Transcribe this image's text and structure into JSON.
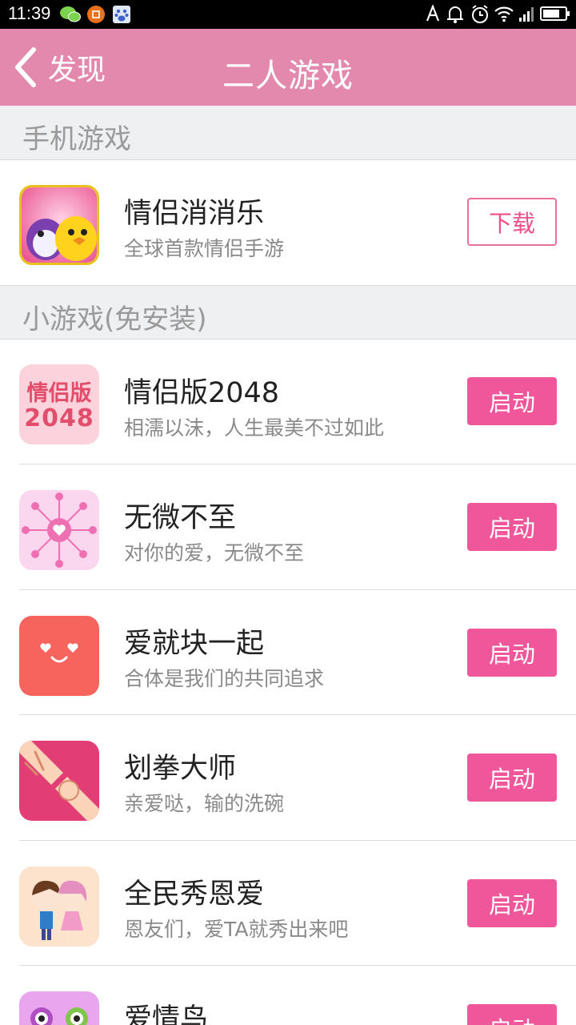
{
  "status_bar": {
    "time": "11:39",
    "icons": [
      "wechat-icon",
      "app-notification-icon",
      "baidu-icon",
      "signal-a-icon",
      "alarm-bell-icon",
      "clock-icon",
      "wifi-icon",
      "cell-signal-icon",
      "battery-icon"
    ]
  },
  "header": {
    "back_label": "发现",
    "title": "二人游戏",
    "color": "#e389ad"
  },
  "sections": [
    {
      "label": "手机游戏",
      "items": [
        {
          "name": "情侣消消乐",
          "desc": "全球首款情侣手游",
          "button": "下载",
          "icon": "couple-match-game-icon"
        }
      ]
    },
    {
      "label": "小游戏(免安装)",
      "items": [
        {
          "name": "情侣版2048",
          "desc": "相濡以沫，人生最美不过如此",
          "button": "启动",
          "icon": "couple-2048-icon",
          "icon_text": [
            "情侣版",
            "2048"
          ]
        },
        {
          "name": "无微不至",
          "desc": "对你的爱，无微不至",
          "button": "启动",
          "icon": "heart-wheel-icon"
        },
        {
          "name": "爱就块一起",
          "desc": "合体是我们的共同追求",
          "button": "启动",
          "icon": "smiley-block-icon"
        },
        {
          "name": "划拳大师",
          "desc": "亲爱哒，输的洗碗",
          "button": "启动",
          "icon": "rock-paper-hands-icon"
        },
        {
          "name": "全民秀恩爱",
          "desc": "恩友们，爱TA就秀出来吧",
          "button": "启动",
          "icon": "kissing-couple-icon"
        },
        {
          "name": "爱情鸟",
          "desc": "",
          "button": "启动",
          "icon": "love-birds-icon"
        }
      ]
    }
  ],
  "colors": {
    "accent": "#f0579a",
    "section_bg": "#eef0f2",
    "desc_text": "#8a8a8a"
  }
}
